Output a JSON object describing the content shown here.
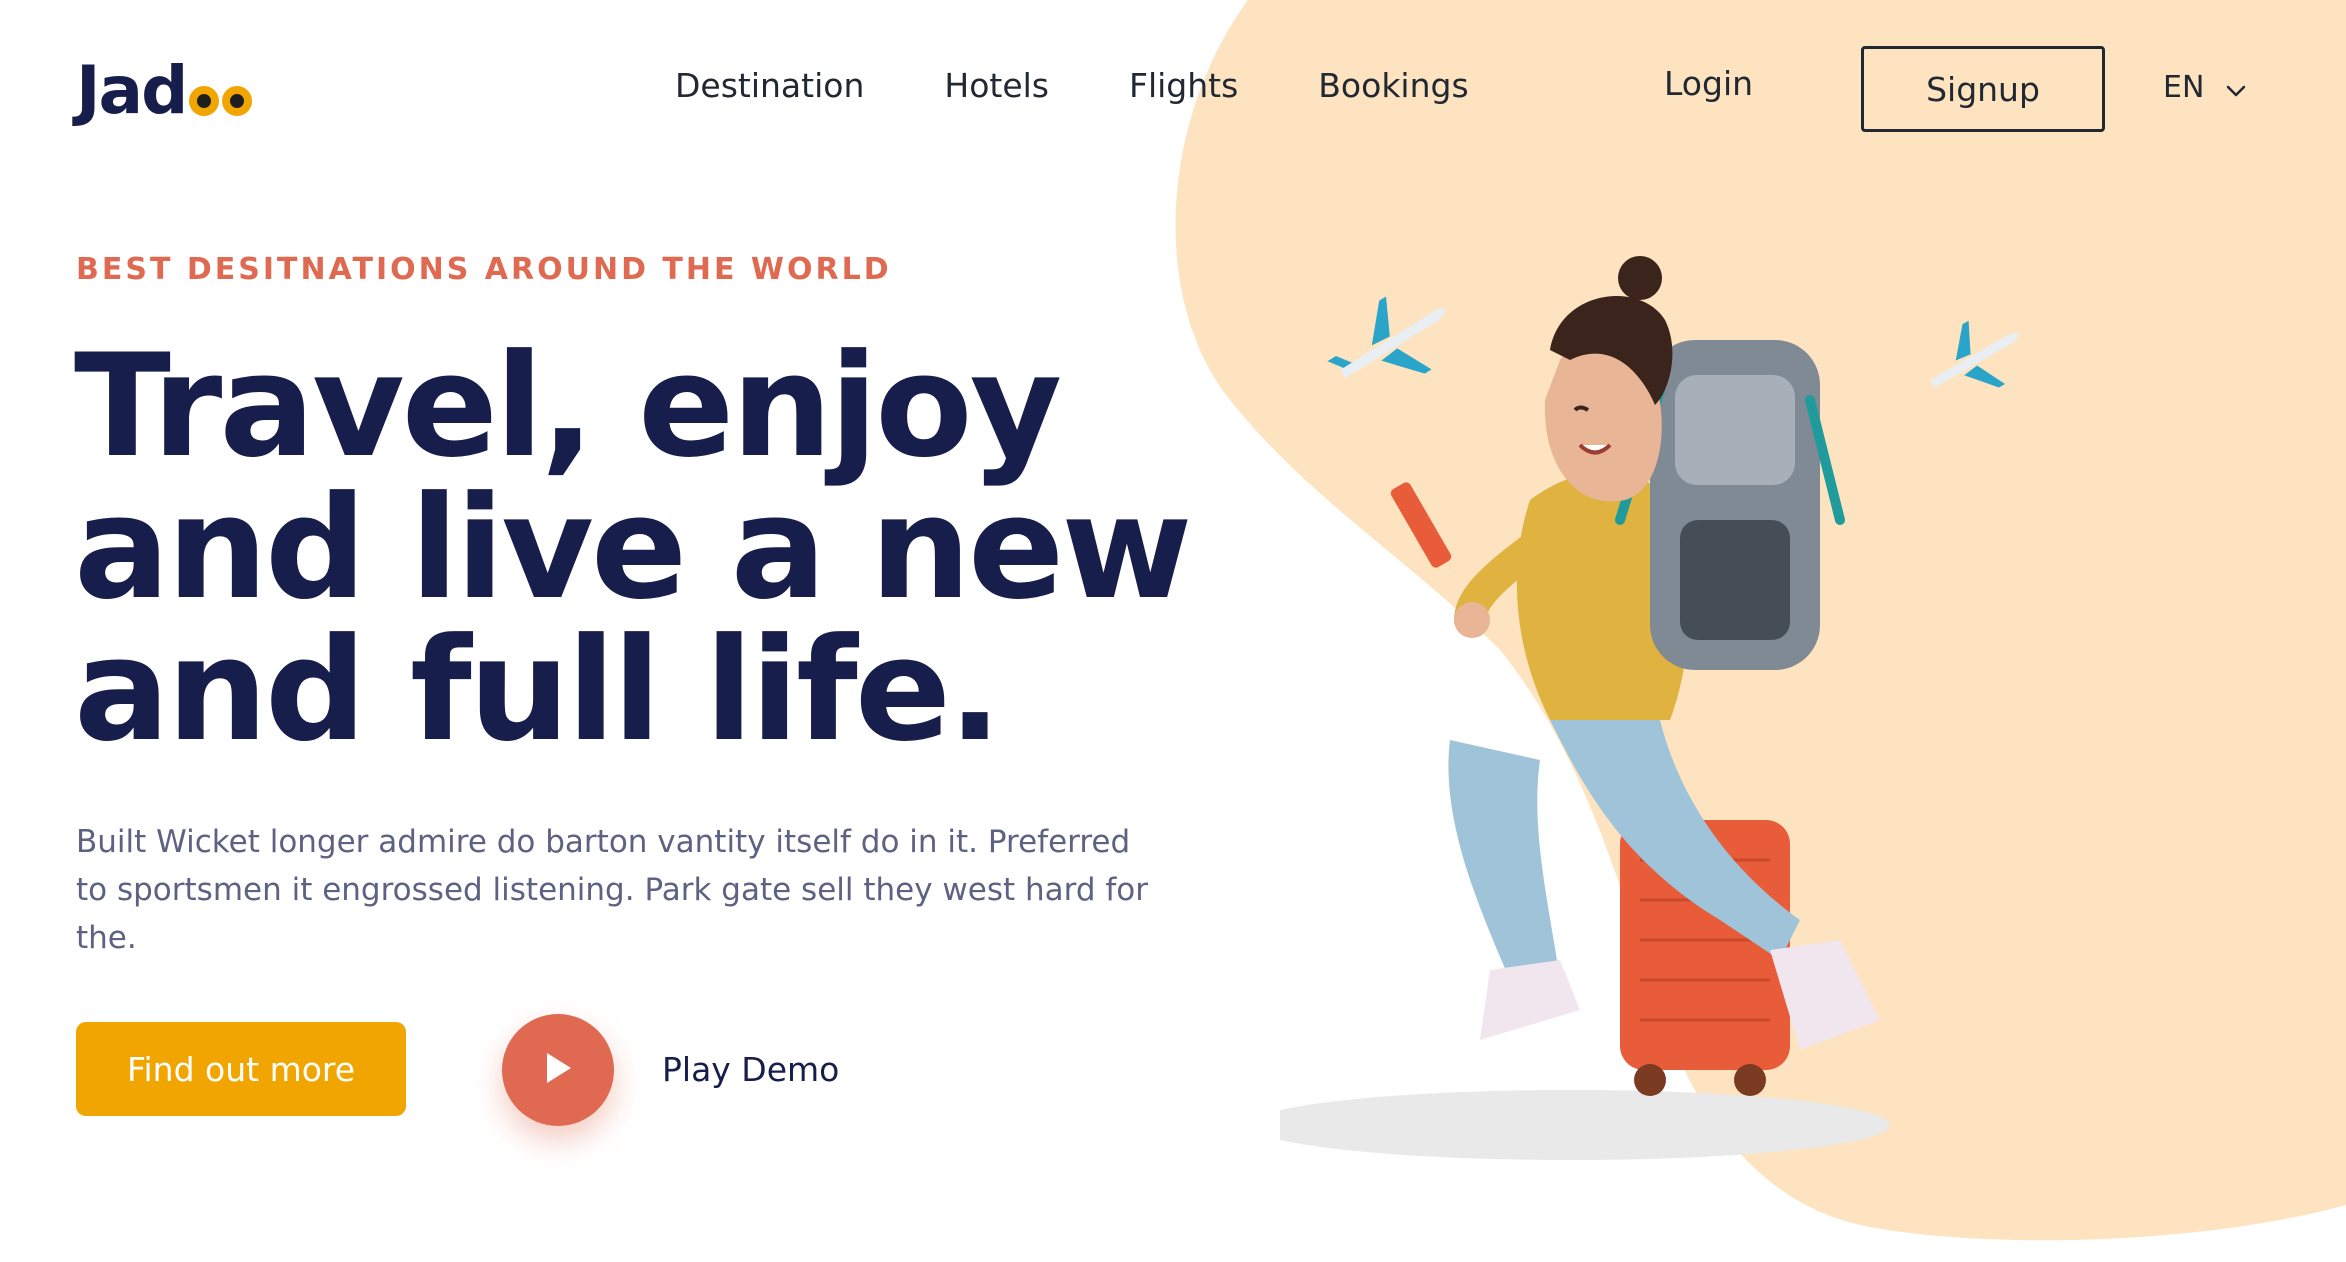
{
  "brand": {
    "logo": "Jad"
  },
  "nav": {
    "items": [
      "Destination",
      "Hotels",
      "Flights",
      "Bookings"
    ]
  },
  "auth": {
    "login": "Login",
    "signup": "Signup"
  },
  "language": {
    "selected": "EN"
  },
  "hero": {
    "eyebrow": "BEST DESITNATIONS AROUND THE WORLD",
    "headline": "Travel, enjoy and live a new and full life.",
    "description": "Built Wicket longer admire do barton vantity itself do in it. Preferred to sportsmen it engrossed listening. Park gate sell they west hard for the.",
    "cta": "Find out more",
    "play_label": "Play Demo"
  },
  "colors": {
    "primary": "#f1a501",
    "accent": "#df6951",
    "dark": "#181e4b",
    "blob": "#fff1da",
    "text": "#5e6282"
  },
  "icons": [
    "play-icon",
    "chevron-down-icon",
    "airplane-icon"
  ]
}
